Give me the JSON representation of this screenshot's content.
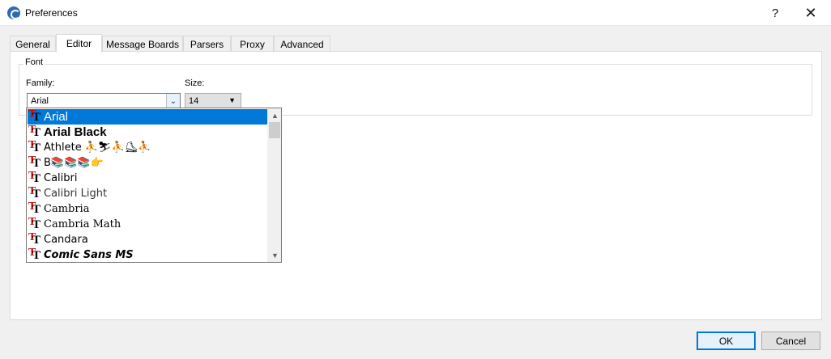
{
  "window": {
    "title": "Preferences",
    "help_label": "?",
    "close_label": "✕"
  },
  "tabs": [
    {
      "label": "General"
    },
    {
      "label": "Editor"
    },
    {
      "label": "Message Boards"
    },
    {
      "label": "Parsers"
    },
    {
      "label": "Proxy"
    },
    {
      "label": "Advanced"
    }
  ],
  "active_tab": "Editor",
  "font_group": {
    "title": "Font",
    "family_label": "Family:",
    "family_value": "Arial",
    "size_label": "Size:",
    "size_value": "14"
  },
  "font_list": [
    {
      "label": "Arial",
      "selected": true
    },
    {
      "label": "Arial Black"
    },
    {
      "label": "Athlete ⛹⛷⛹⛸⛹"
    },
    {
      "label": "B📚📚📚👉"
    },
    {
      "label": "Calibri"
    },
    {
      "label": "Calibri Light"
    },
    {
      "label": "Cambria"
    },
    {
      "label": "Cambria Math"
    },
    {
      "label": "Candara"
    },
    {
      "label": "Comic Sans MS"
    }
  ],
  "buttons": {
    "ok": "OK",
    "cancel": "Cancel"
  },
  "colors": {
    "selection": "#0078d7",
    "truetype_icon_red": "#d00000"
  },
  "icons": {
    "app": "app-logo-icon",
    "font_type": "truetype-font-icon",
    "combo_arrow": "chevron-down-icon"
  }
}
